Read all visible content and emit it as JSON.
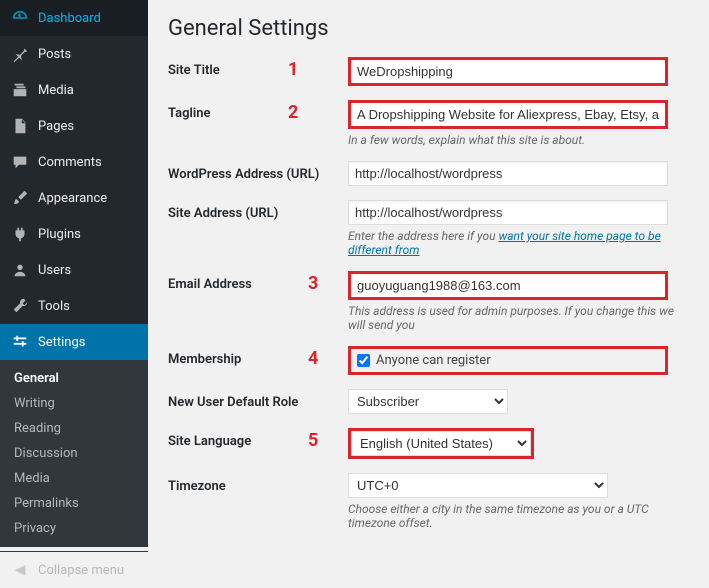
{
  "sidebar": {
    "items": [
      {
        "label": "Dashboard"
      },
      {
        "label": "Posts"
      },
      {
        "label": "Media"
      },
      {
        "label": "Pages"
      },
      {
        "label": "Comments"
      },
      {
        "label": "Appearance"
      },
      {
        "label": "Plugins"
      },
      {
        "label": "Users"
      },
      {
        "label": "Tools"
      },
      {
        "label": "Settings"
      }
    ],
    "submenu": [
      {
        "label": "General"
      },
      {
        "label": "Writing"
      },
      {
        "label": "Reading"
      },
      {
        "label": "Discussion"
      },
      {
        "label": "Media"
      },
      {
        "label": "Permalinks"
      },
      {
        "label": "Privacy"
      }
    ],
    "collapse_label": "Collapse menu"
  },
  "page": {
    "title": "General Settings"
  },
  "annotations": {
    "n1": "1",
    "n2": "2",
    "n3": "3",
    "n4": "4",
    "n5": "5"
  },
  "form": {
    "site_title": {
      "label": "Site Title",
      "value": "WeDropshipping"
    },
    "tagline": {
      "label": "Tagline",
      "value": "A Dropshipping Website for Aliexpress, Ebay, Etsy, and",
      "desc": "In a few words, explain what this site is about."
    },
    "wp_address": {
      "label": "WordPress Address (URL)",
      "value": "http://localhost/wordpress"
    },
    "site_address": {
      "label": "Site Address (URL)",
      "value": "http://localhost/wordpress",
      "desc_pre": "Enter the address here if you ",
      "desc_link": "want your site home page to be different from "
    },
    "email": {
      "label": "Email Address",
      "value": "guoyuguang1988@163.com",
      "desc": "This address is used for admin purposes. If you change this we will send you"
    },
    "membership": {
      "label": "Membership",
      "checkbox_label": "Anyone can register",
      "checked": true
    },
    "default_role": {
      "label": "New User Default Role",
      "value": "Subscriber"
    },
    "language": {
      "label": "Site Language",
      "value": "English (United States)"
    },
    "timezone": {
      "label": "Timezone",
      "value": "UTC+0",
      "desc": "Choose either a city in the same timezone as you or a UTC timezone offset."
    }
  }
}
